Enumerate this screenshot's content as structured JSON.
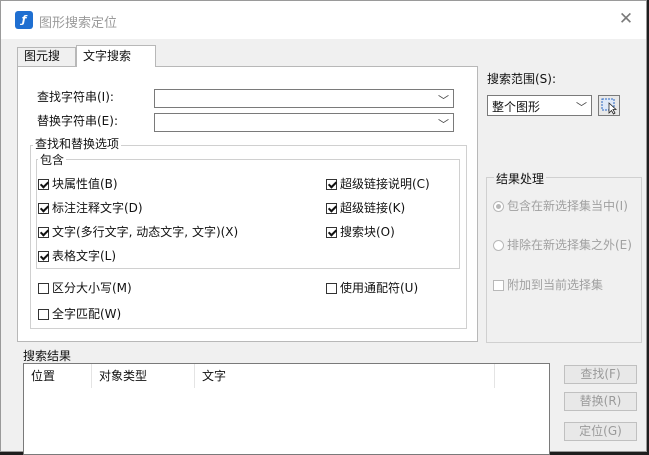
{
  "window": {
    "title": "图形搜索定位",
    "close_glyph": "✕"
  },
  "tabs": [
    {
      "label": "图元搜索"
    },
    {
      "label": "文字搜索"
    }
  ],
  "find": {
    "label": "查找字符串(I):",
    "value": ""
  },
  "replace": {
    "label": "替换字符串(E):",
    "value": ""
  },
  "options": {
    "title": "查找和替换选项",
    "include": {
      "title": "包含",
      "left": [
        {
          "label": "块属性值(B)",
          "checked": true
        },
        {
          "label": "标注注释文字(D)",
          "checked": true
        },
        {
          "label": "文字(多行文字, 动态文字, 文字)(X)",
          "checked": true
        },
        {
          "label": "表格文字(L)",
          "checked": true
        }
      ],
      "right": [
        {
          "label": "超级链接说明(C)",
          "checked": true
        },
        {
          "label": "超级链接(K)",
          "checked": true
        },
        {
          "label": "搜索块(O)",
          "checked": true
        }
      ]
    },
    "match_case": {
      "label": "区分大小写(M)",
      "checked": false
    },
    "whole_word": {
      "label": "全字匹配(W)",
      "checked": false
    },
    "wildcards": {
      "label": "使用通配符(U)",
      "checked": false
    }
  },
  "scope": {
    "label": "搜索范围(S):",
    "value": "整个图形"
  },
  "result_handling": {
    "title": "结果处理",
    "include_new": {
      "label": "包含在新选择集当中(I)",
      "selected": true
    },
    "exclude_new": {
      "label": "排除在新选择集之外(E)",
      "selected": false
    },
    "append": {
      "label": "附加到当前选择集",
      "checked": false
    }
  },
  "results": {
    "label": "搜索结果",
    "columns": [
      {
        "label": "位置"
      },
      {
        "label": "对象类型"
      },
      {
        "label": "文字"
      }
    ]
  },
  "buttons": {
    "find": "查找(F)",
    "replace": "替换(R)",
    "locate": "定位(G)"
  }
}
